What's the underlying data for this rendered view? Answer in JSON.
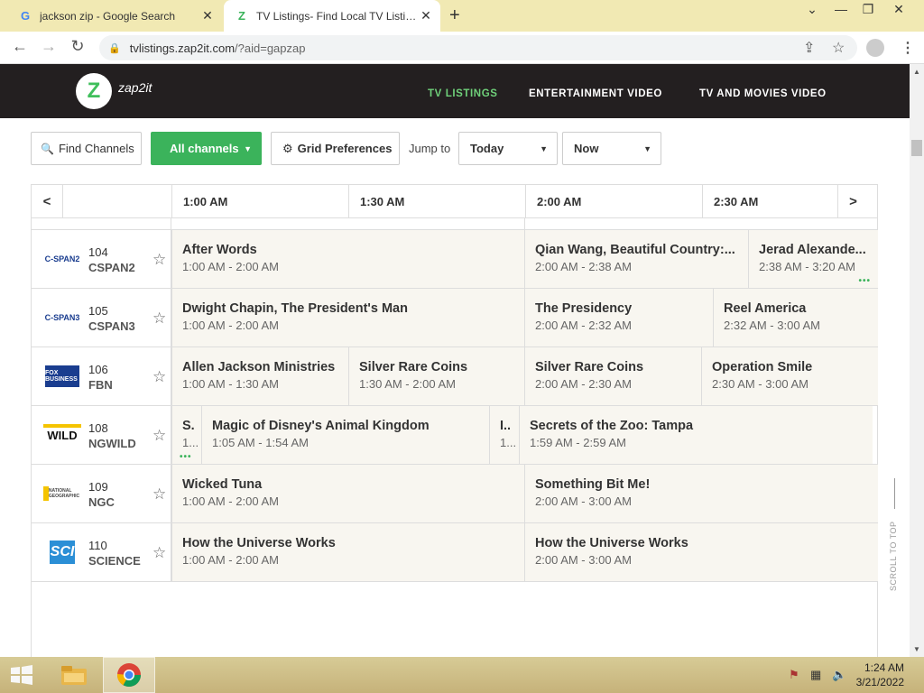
{
  "browser": {
    "tabs": [
      {
        "title": "jackson zip - Google Search",
        "favicon": "G"
      },
      {
        "title": "TV Listings- Find Local TV Listings",
        "favicon": "Z"
      }
    ],
    "url_host": "tvlistings.zap2it.com",
    "url_path": "/?aid=gapzap"
  },
  "site": {
    "logo_text": "zap2it",
    "logo_letter": "Z",
    "nav": [
      "TV LISTINGS",
      "ENTERTAINMENT VIDEO",
      "TV AND MOVIES VIDEO"
    ],
    "accent": "#3bb35b"
  },
  "filters": {
    "find_channels": "Find Channels",
    "all_channels": "All channels",
    "grid_prefs": "Grid Preferences",
    "jump_to": "Jump to",
    "day": "Today",
    "time": "Now"
  },
  "times": [
    "1:00 AM",
    "1:30 AM",
    "2:00 AM",
    "2:30 AM"
  ],
  "channels": [
    {
      "logo": "C-SPAN2",
      "number": "104",
      "callsign": "CSPAN2",
      "programs": [
        {
          "title": "After Words",
          "time": "1:00 AM - 2:00 AM"
        },
        {
          "title": "Qian Wang, Beautiful Country:...",
          "time": "2:00 AM - 2:38 AM"
        },
        {
          "title": "Jerad Alexande...",
          "time": "2:38 AM - 3:20 AM"
        }
      ]
    },
    {
      "logo": "C-SPAN3",
      "number": "105",
      "callsign": "CSPAN3",
      "programs": [
        {
          "title": "Dwight Chapin, The President's Man",
          "time": "1:00 AM - 2:00 AM"
        },
        {
          "title": "The Presidency",
          "time": "2:00 AM - 2:32 AM"
        },
        {
          "title": "Reel America",
          "time": "2:32 AM - 3:00 AM"
        }
      ]
    },
    {
      "logo": "FOX BUSINESS",
      "number": "106",
      "callsign": "FBN",
      "programs": [
        {
          "title": "Allen Jackson Ministries",
          "time": "1:00 AM - 1:30 AM"
        },
        {
          "title": "Silver Rare Coins",
          "time": "1:30 AM - 2:00 AM"
        },
        {
          "title": "Silver Rare Coins",
          "time": "2:00 AM - 2:30 AM"
        },
        {
          "title": "Operation Smile",
          "time": "2:30 AM - 3:00 AM"
        }
      ]
    },
    {
      "logo": "WILD",
      "number": "108",
      "callsign": "NGWILD",
      "programs": [
        {
          "title": "S.",
          "time": "1..."
        },
        {
          "title": "Magic of Disney's Animal Kingdom",
          "time": "1:05 AM - 1:54 AM"
        },
        {
          "title": "I..",
          "time": "1..."
        },
        {
          "title": "Secrets of the Zoo: Tampa",
          "time": "1:59 AM - 2:59 AM"
        }
      ]
    },
    {
      "logo": "NATIONAL GEOGRAPHIC",
      "number": "109",
      "callsign": "NGC",
      "programs": [
        {
          "title": "Wicked Tuna",
          "time": "1:00 AM - 2:00 AM"
        },
        {
          "title": "Something Bit Me!",
          "time": "2:00 AM - 3:00 AM"
        }
      ]
    },
    {
      "logo": "SCI",
      "number": "110",
      "callsign": "SCIENCE",
      "programs": [
        {
          "title": "How the Universe Works",
          "time": "1:00 AM - 2:00 AM"
        },
        {
          "title": "How the Universe Works",
          "time": "2:00 AM - 3:00 AM"
        }
      ]
    }
  ],
  "scroll_to_top": "SCROLL TO TOP",
  "taskbar": {
    "time": "1:24 AM",
    "date": "3/21/2022"
  }
}
